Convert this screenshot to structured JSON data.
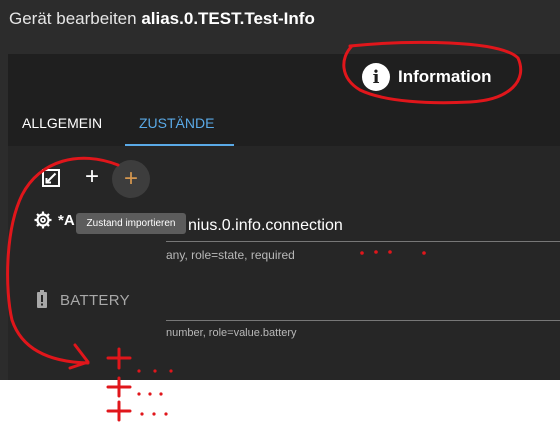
{
  "dialog": {
    "title_prefix": "Gerät bearbeiten",
    "title_object": "alias.0.TEST.Test-Info"
  },
  "info_button": {
    "icon": "info-icon",
    "label": "Information"
  },
  "tabs": [
    {
      "label": "ALLGEMEIN",
      "active": false
    },
    {
      "label": "ZUSTÄNDE",
      "active": true
    }
  ],
  "toolbar": {
    "expand_icon": "expand-icon",
    "add_icon": "plus-icon",
    "import_icon": "plus-icon",
    "import_tooltip": "Zustand importieren"
  },
  "states": [
    {
      "icon": "gear-icon",
      "name": "*A",
      "id": "nius.0.info.connection",
      "help": "any, role=state, required"
    },
    {
      "icon": "battery-icon",
      "name": "BATTERY",
      "id": "",
      "help": "number, role=value.battery"
    }
  ],
  "annotation": {
    "color": "#e0161b"
  },
  "colors": {
    "accent": "#5aa9e6",
    "import_plus": "#d4964f",
    "dialog_bg": "#2c2c2c"
  }
}
